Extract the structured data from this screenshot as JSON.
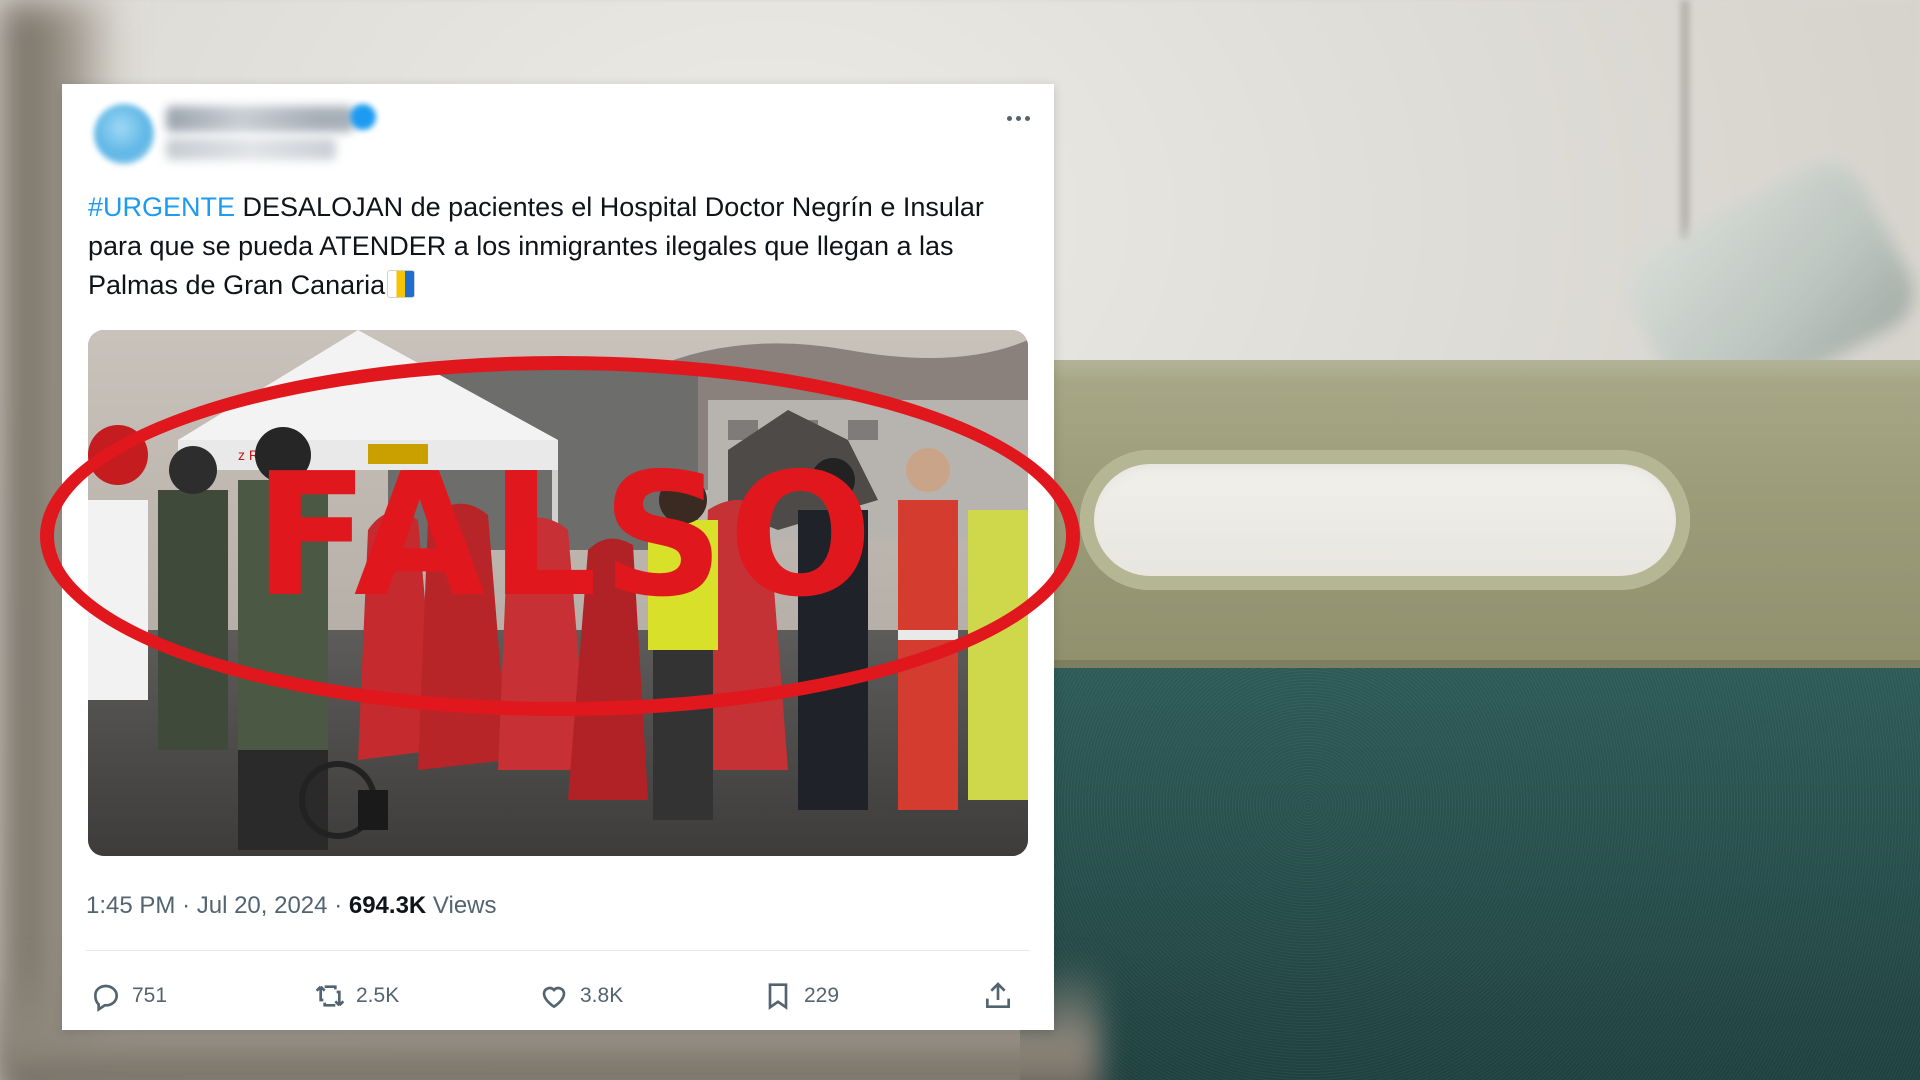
{
  "tweet": {
    "hashtag": "#URGENTE",
    "text_rest": " DESALOJAN de pacientes el Hospital Doctor Negrín e Insular para que se pueda ATENDER a los inmigrantes ilegales que llegan a las Palmas de Gran Canaria",
    "time": "1:45 PM",
    "date": "Jul 20, 2024",
    "views_count": "694.3K",
    "views_label": "Views",
    "replies": "751",
    "retweets": "2.5K",
    "likes": "3.8K",
    "bookmarks": "229",
    "media_text": {
      "tent_label": "z Roja"
    }
  },
  "stamp": {
    "word": "FALSO",
    "color": "#e0181d"
  },
  "colors": {
    "hashtag": "#1d9bf0",
    "text": "#0f1419",
    "muted": "#536471"
  },
  "icons": [
    "more-icon",
    "flag-icon",
    "reply-icon",
    "retweet-icon",
    "like-icon",
    "bookmark-icon",
    "share-icon"
  ]
}
